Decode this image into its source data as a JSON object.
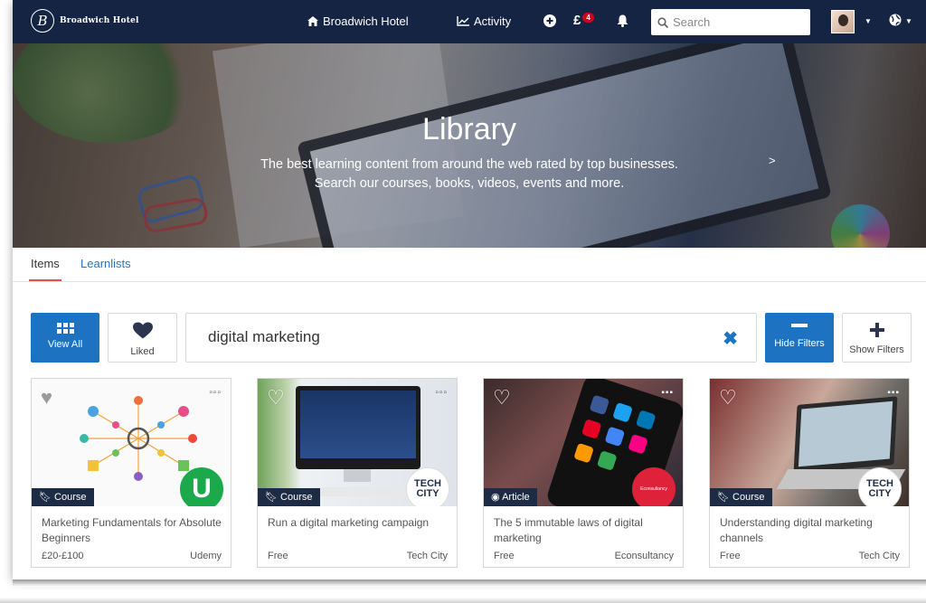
{
  "brand": {
    "name": "Broadwich Hotel",
    "logo_letter": "B"
  },
  "nav": {
    "home_label": "Broadwich Hotel",
    "activity_label": "Activity",
    "currency_symbol": "£",
    "currency_badge": "4",
    "search_placeholder": "Search"
  },
  "hero": {
    "title": "Library",
    "subtitle_line1": "The best learning content from around the web rated by top businesses.",
    "subtitle_line2": "Search our courses, books, videos, events and more.",
    "arrow": ">"
  },
  "tabs": [
    {
      "label": "Items",
      "active": true
    },
    {
      "label": "Learnlists",
      "active": false
    }
  ],
  "filters": {
    "view_all_label": "View All",
    "liked_label": "Liked",
    "query": "digital marketing",
    "hide_filters_label": "Hide Filters",
    "show_filters_label": "Show Filters"
  },
  "cards": [
    {
      "type": "Course",
      "title": "Marketing Fundamentals for Absolute Beginners",
      "price": "£20-£100",
      "provider": "Udemy",
      "logo_text": "U",
      "logo_color": "#1ba94c"
    },
    {
      "type": "Course",
      "title": "Run a digital marketing campaign",
      "price": "Free",
      "provider": "Tech City",
      "logo_text": "TECH CITY",
      "logo_color": "#1d2b45"
    },
    {
      "type": "Article",
      "title": "The 5 immutable laws of digital marketing",
      "price": "Free",
      "provider": "Econsultancy",
      "logo_text": "Econsultancy",
      "logo_color": "#e0213a"
    },
    {
      "type": "Course",
      "title": "Understanding digital marketing channels",
      "price": "Free",
      "provider": "Tech City",
      "logo_text": "TECH CITY",
      "logo_color": "#1d2b45"
    }
  ],
  "colors": {
    "navbar": "#162443",
    "primary": "#1d72c2",
    "tab_underline": "#e2524a",
    "badge": "#d0021b"
  }
}
